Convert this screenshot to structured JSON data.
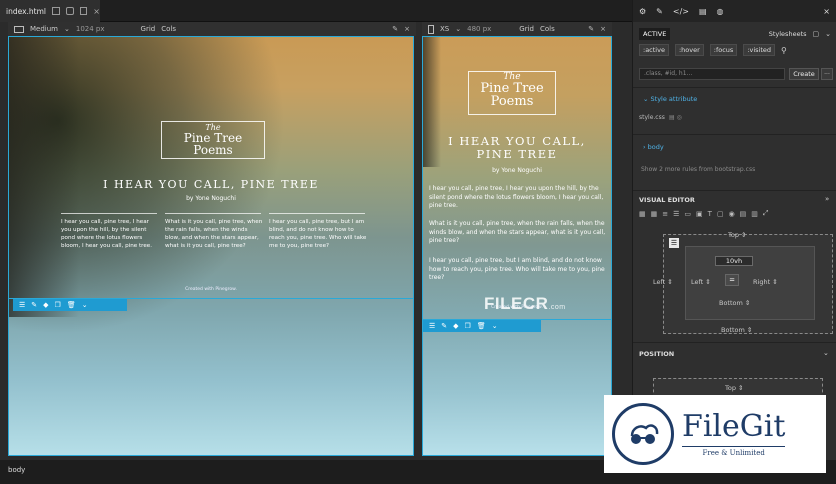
{
  "tabbar": {
    "tab_label": "index.html",
    "close": "×"
  },
  "panes": {
    "main": {
      "device": "Medium",
      "width": "1024 px",
      "grid": "Grid",
      "cols": "Cols"
    },
    "xs": {
      "device": "XS",
      "width": "480 px",
      "grid": "Grid",
      "cols": "Cols"
    }
  },
  "page": {
    "logo_the": "The",
    "logo_line1": "Pine Tree",
    "logo_line2": "Poems",
    "headline": "I HEAR YOU CALL, PINE TREE",
    "headline_xs_1": "I HEAR YOU CALL,",
    "headline_xs_2": "PINE TREE",
    "byline": "by Yone Noguchi",
    "poems": [
      "I hear you call, pine tree, I hear you upon the hill, by the silent pond where the lotus flowers bloom, I hear you call, pine tree.",
      "What is it you call, pine tree, when the rain falls, when the winds blow, and when the stars appear, what is it you call, pine tree?",
      "I hear you call, pine tree, but I am blind, and do not know how to reach you, pine tree. Who will take me to you, pine tree?"
    ],
    "credit": "Created with Pinegrow.",
    "credit_xs": "Created with Pinegrow."
  },
  "right_panel": {
    "close": "×",
    "active_label": "ACTIVE",
    "stylesheets_label": "Stylesheets",
    "pseudo": [
      ":active",
      ":hover",
      ":focus",
      ":visited"
    ],
    "filter_placeholder": ".class, #id, h1...",
    "create_label": "Create",
    "more_label": "...",
    "style_attribute": "Style attribute",
    "style_css": "style.css",
    "body_rule": "body",
    "more_rules": "Show 2 more rules from bootstrap.css",
    "visual_editor": "VISUAL EDITOR",
    "spacing": {
      "top": "Top",
      "left": "Left",
      "right": "Right",
      "bottom": "Bottom",
      "height": "10vh",
      "center": "="
    },
    "position": "POSITION",
    "pos_top": "Top"
  },
  "statusbar": {
    "label": "body"
  },
  "watermarks": {
    "filecr": "FILECR",
    "filecr_sub": ".com",
    "filegit_name": "FileGit",
    "filegit_tag": "Free & Unlimited"
  },
  "colors": {
    "accent": "#2aa9d8",
    "toolbar": "#1f9bd1",
    "brand_navy": "#1f3c67",
    "link_blue": "#4fb2e6"
  }
}
